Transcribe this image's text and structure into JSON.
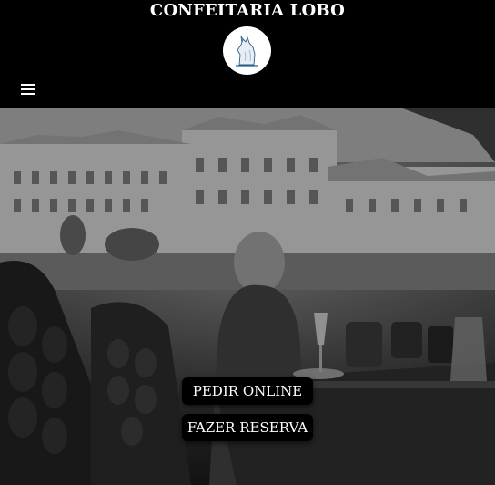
{
  "header": {
    "brand_name": "CONFEITARIA LOBO",
    "logo_icon": "wolf-logo-icon",
    "menu_icon": "hamburger-menu-icon"
  },
  "hero": {
    "image_icon": "cafe-street-photo",
    "buttons": {
      "order_online": "PEDIR ONLINE",
      "make_reservation": "FAZER RESERVA"
    }
  },
  "colors": {
    "header_bg": "#000000",
    "button_bg": "#000000",
    "text": "#ffffff"
  }
}
